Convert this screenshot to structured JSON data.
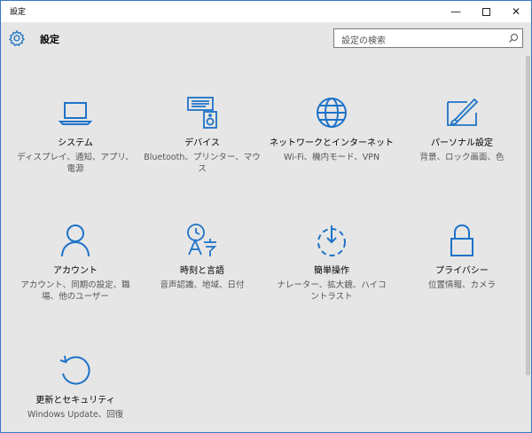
{
  "window": {
    "title": "設定"
  },
  "header": {
    "title": "設定",
    "search_placeholder": "設定の検索"
  },
  "tiles": [
    {
      "name": "システム",
      "desc": "ディスプレイ、通知、アプリ、電源",
      "icon": "laptop-icon"
    },
    {
      "name": "デバイス",
      "desc": "Bluetooth、プリンター、マウス",
      "icon": "devices-icon"
    },
    {
      "name": "ネットワークとインターネット",
      "desc": "Wi-Fi、機内モード、VPN",
      "icon": "globe-icon"
    },
    {
      "name": "パーソナル設定",
      "desc": "背景、ロック画面、色",
      "icon": "paint-icon"
    },
    {
      "name": "アカウント",
      "desc": "アカウント、同期の設定、職場、他のユーザー",
      "icon": "person-icon"
    },
    {
      "name": "時刻と言語",
      "desc": "音声認識、地域、日付",
      "icon": "time-language-icon"
    },
    {
      "name": "簡単操作",
      "desc": "ナレーター、拡大鏡、ハイコントラスト",
      "icon": "ease-of-access-icon"
    },
    {
      "name": "プライバシー",
      "desc": "位置情報、カメラ",
      "icon": "lock-icon"
    },
    {
      "name": "更新とセキュリティ",
      "desc": "Windows Update、回復",
      "icon": "update-icon"
    }
  ],
  "colors": {
    "accent": "#1e73c8",
    "background": "#e6e6e6"
  }
}
